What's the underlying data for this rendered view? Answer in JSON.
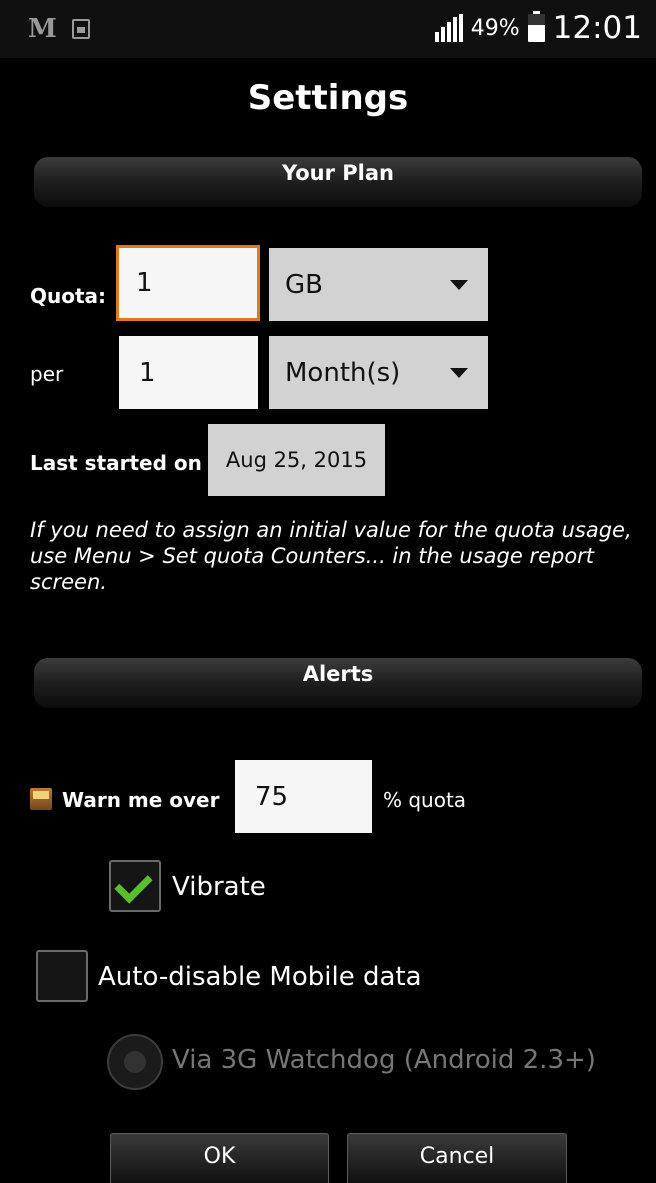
{
  "status_bar": {
    "left_icons": [
      "m-app-icon",
      "image-notification-icon"
    ],
    "m_glyph": "M",
    "battery_percent": "49%",
    "time": "12:01",
    "signal_icon": "signal-icon",
    "battery_icon": "battery-icon"
  },
  "header": {
    "title": "Settings"
  },
  "plan_section": {
    "title": "Your Plan",
    "quota_label": "Quota:",
    "quota_value": "1",
    "quota_unit": "GB",
    "per_label": "per",
    "period_value": "1",
    "period_unit": "Month(s)",
    "last_started_label": "Last started on",
    "last_started_date": "Aug 25, 2015",
    "note": "If you need to assign an initial value for the quota usage, use Menu > Set quota Counters... in the usage report screen."
  },
  "alerts_section": {
    "title": "Alerts",
    "warn_label": "Warn me over",
    "warn_value": "75",
    "warn_suffix": "% quota",
    "vibrate_label": "Vibrate",
    "vibrate_checked": true,
    "auto_disable_label": "Auto-disable Mobile data",
    "auto_disable_checked": false,
    "watchdog_label": "Via 3G Watchdog (Android 2.3+)",
    "watchdog_enabled": false
  },
  "buttons": {
    "ok": "OK",
    "cancel": "Cancel"
  },
  "colors": {
    "focus_border": "#e07a1a",
    "check_green": "#58c02a",
    "background": "#000000"
  }
}
